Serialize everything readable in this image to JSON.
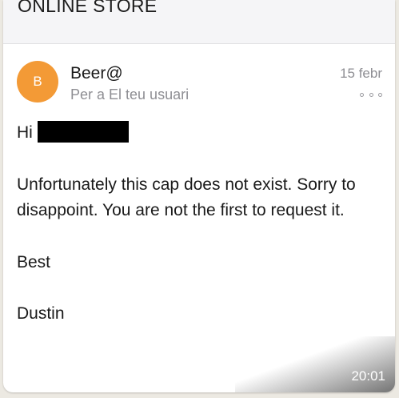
{
  "message": {
    "subject": "ONLINE STORE",
    "avatar_letter": "B",
    "sender": "Beer@",
    "recipient": "Per a El teu usuari",
    "date": "15 febr",
    "greeting": "Hi",
    "paragraph_1_line_1": "Unfortunately this cap does not exist. Sorry to",
    "paragraph_1_line_2": "disappoint. You are not the first to request it.",
    "closing": "Best",
    "signature": "Dustin",
    "timestamp": "20:01"
  },
  "colors": {
    "avatar": "#f39a36",
    "secondary_text": "#8e8e93",
    "background": "#ece9e2"
  },
  "icons": {
    "more": "more-options-icon"
  }
}
